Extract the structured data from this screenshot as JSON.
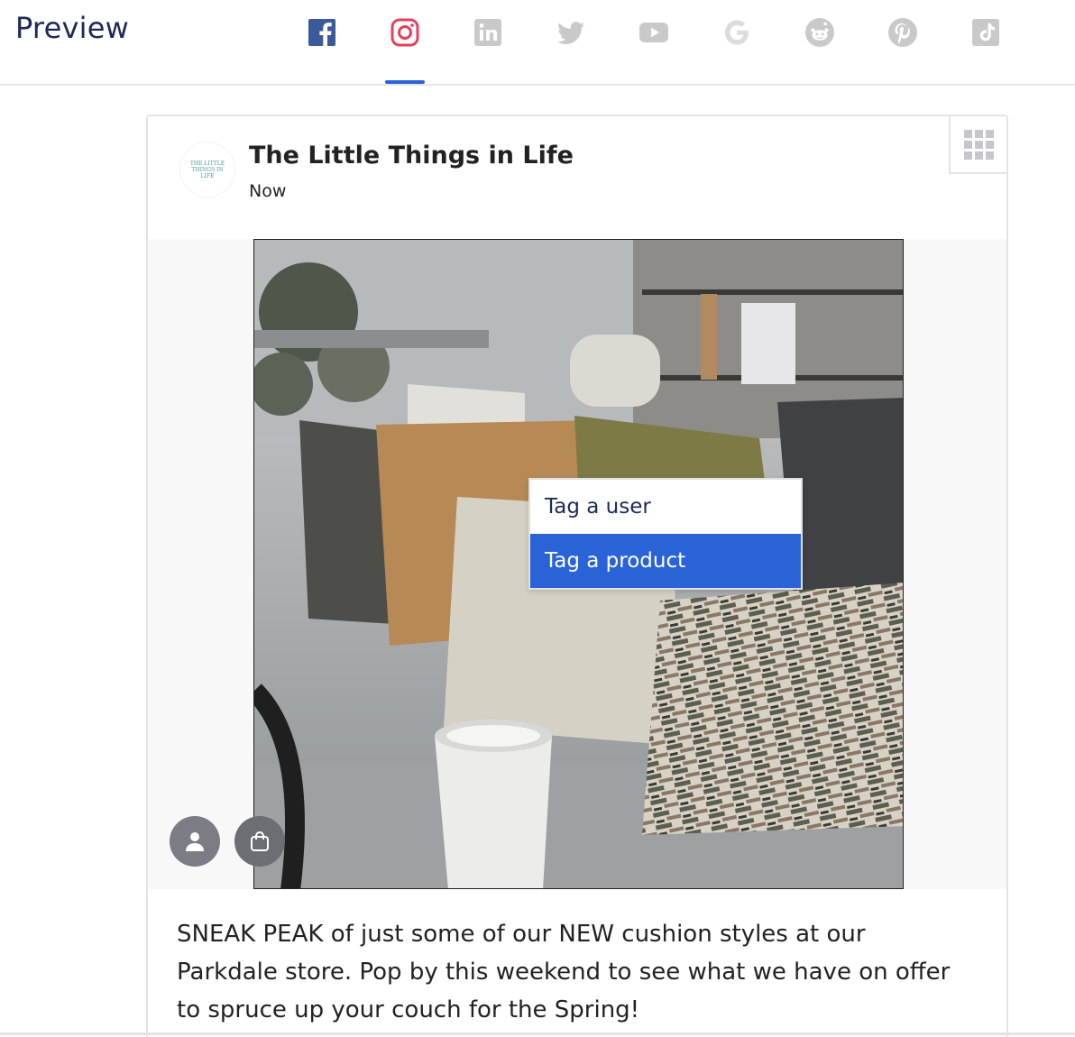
{
  "header": {
    "title": "Preview",
    "active_tab": "instagram",
    "accent_color": "#2a62d8",
    "tabs": [
      {
        "id": "facebook",
        "icon": "facebook-icon"
      },
      {
        "id": "instagram",
        "icon": "instagram-icon"
      },
      {
        "id": "linkedin",
        "icon": "linkedin-icon"
      },
      {
        "id": "twitter",
        "icon": "twitter-icon"
      },
      {
        "id": "youtube",
        "icon": "youtube-icon"
      },
      {
        "id": "google",
        "icon": "google-icon"
      },
      {
        "id": "reddit",
        "icon": "reddit-icon"
      },
      {
        "id": "pinterest",
        "icon": "pinterest-icon"
      },
      {
        "id": "tiktok",
        "icon": "tiktok-icon"
      }
    ]
  },
  "post": {
    "account_name": "The Little Things in Life",
    "avatar_text": "THE LITTLE THINGS IN LIFE",
    "timestamp": "Now",
    "caption": "SNEAK PEAK of just some of our NEW cushion styles at our Parkdale store. Pop by this weekend to see what we have on offer to spruce up your couch for the Spring!"
  },
  "tag_menu": {
    "items": [
      {
        "label": "Tag a user",
        "active": false
      },
      {
        "label": "Tag a product",
        "active": true
      }
    ]
  },
  "media_actions": {
    "tag_user_icon": "user-icon",
    "tag_product_icon": "shopping-bag-icon"
  }
}
